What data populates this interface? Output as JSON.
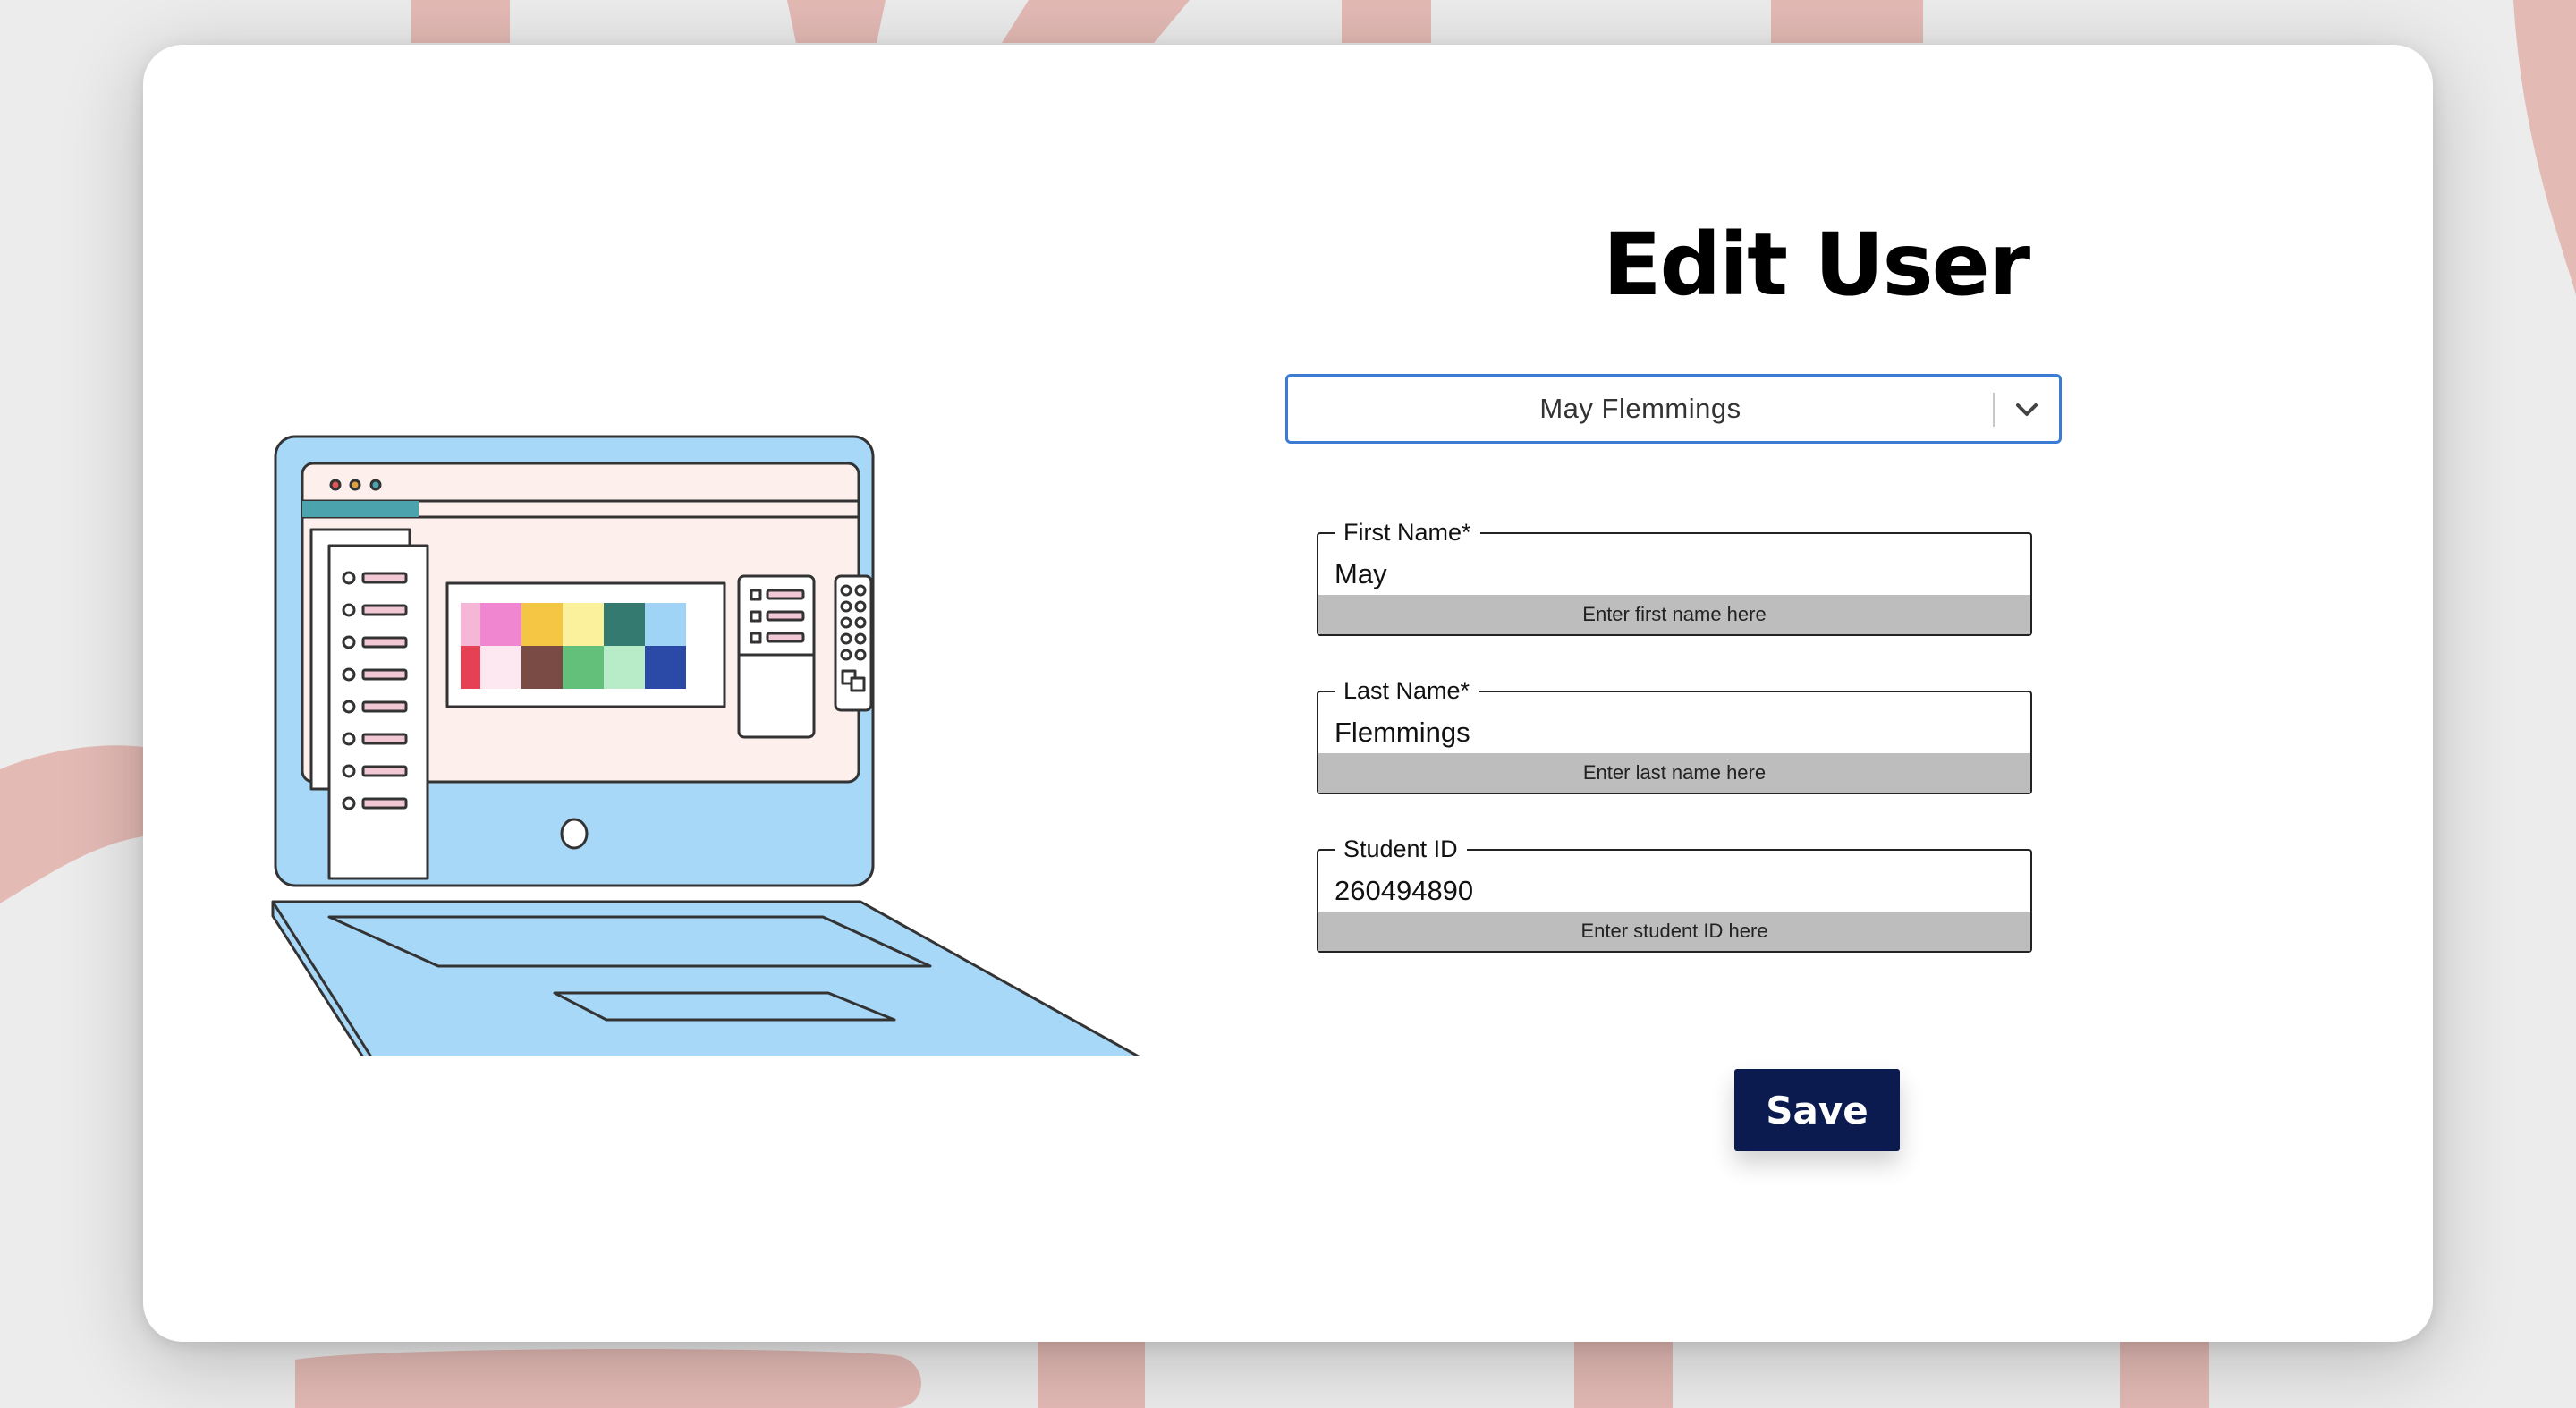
{
  "page": {
    "title": "Edit User"
  },
  "user_select": {
    "selected": "May Flemmings",
    "icon": "chevron-down-icon"
  },
  "fields": {
    "first_name": {
      "label": "First Name*",
      "value": "May",
      "helper": "Enter first name here"
    },
    "last_name": {
      "label": "Last Name*",
      "value": "Flemmings",
      "helper": "Enter last name here"
    },
    "student_id": {
      "label": "Student ID",
      "value": "260494890",
      "helper": "Enter student ID here"
    }
  },
  "actions": {
    "save_label": "Save"
  },
  "colors": {
    "accent_border": "#3b7bd4",
    "button_bg": "#0b1b4f",
    "helper_bg": "#bdbdbd",
    "illustration_blue": "#a8d8f8",
    "illustration_pink": "#fcefec",
    "backdrop_pink": "#e5bcb7"
  }
}
